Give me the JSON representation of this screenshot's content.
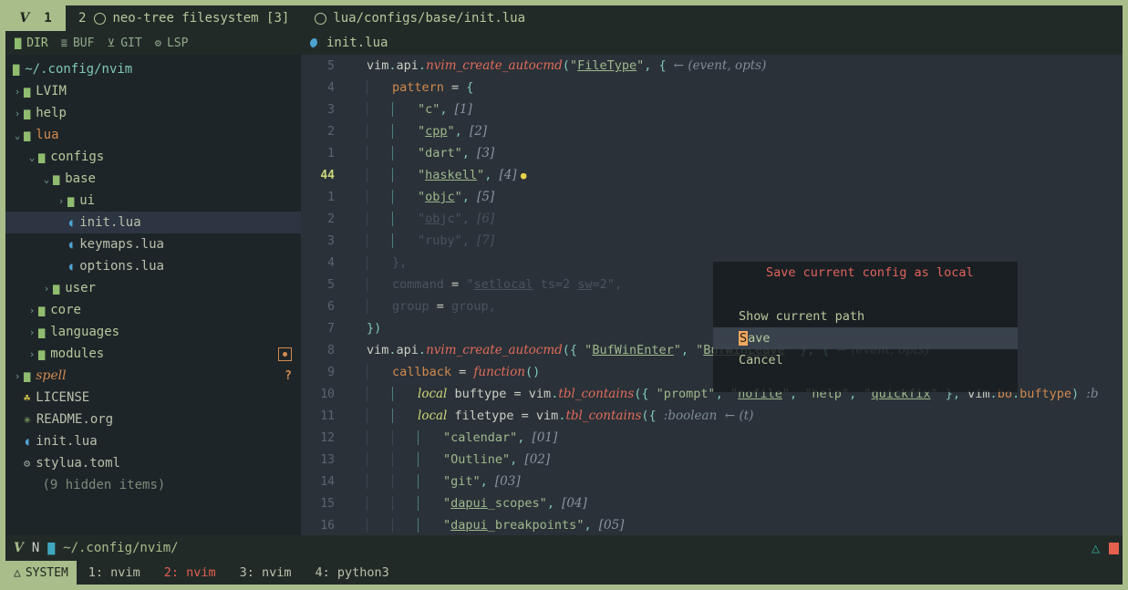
{
  "tabline": {
    "badge": {
      "glyph": "V",
      "count": "1"
    },
    "tabs": [
      {
        "num": "2",
        "icon": "circle-icon",
        "label": "neo-tree filesystem [3]"
      },
      {
        "num": "",
        "icon": "circle-icon",
        "label": "lua/configs/base/init.lua"
      }
    ]
  },
  "winbar": {
    "buttons": [
      {
        "icon": "folder-icon",
        "label": "DIR",
        "active": true
      },
      {
        "icon": "list-icon",
        "label": "BUF",
        "active": false
      },
      {
        "icon": "git-branch-icon",
        "label": "GIT",
        "active": false
      },
      {
        "icon": "gears-icon",
        "label": "LSP",
        "active": false
      }
    ],
    "file": {
      "icon": "lua-icon",
      "label": "init.lua"
    }
  },
  "sidebar": {
    "root": "~/.config/nvim",
    "items": [
      {
        "depth": 1,
        "chev": "›",
        "icon": "folder-icon",
        "label": "LVIM",
        "kind": "dir"
      },
      {
        "depth": 1,
        "chev": "›",
        "icon": "folder-icon",
        "label": "help",
        "kind": "dir"
      },
      {
        "depth": 1,
        "chev": "⌄",
        "icon": "folder-open-icon",
        "label": "lua",
        "kind": "open"
      },
      {
        "depth": 2,
        "chev": "⌄",
        "icon": "folder-open-icon",
        "label": "configs",
        "kind": "dir"
      },
      {
        "depth": 3,
        "chev": "⌄",
        "icon": "folder-open-icon",
        "label": "base",
        "kind": "dir"
      },
      {
        "depth": 4,
        "chev": "›",
        "icon": "folder-icon",
        "label": "ui",
        "kind": "dir"
      },
      {
        "depth": 4,
        "chev": "",
        "icon": "lua-icon",
        "label": "init.lua",
        "kind": "file",
        "selected": true
      },
      {
        "depth": 4,
        "chev": "",
        "icon": "lua-icon",
        "label": "keymaps.lua",
        "kind": "file"
      },
      {
        "depth": 4,
        "chev": "",
        "icon": "lua-icon",
        "label": "options.lua",
        "kind": "file"
      },
      {
        "depth": 3,
        "chev": "›",
        "icon": "folder-icon",
        "label": "user",
        "kind": "dir"
      },
      {
        "depth": 2,
        "chev": "›",
        "icon": "folder-icon",
        "label": "core",
        "kind": "dir"
      },
      {
        "depth": 2,
        "chev": "›",
        "icon": "folder-icon",
        "label": "languages",
        "kind": "dir"
      },
      {
        "depth": 2,
        "chev": "›",
        "icon": "folder-icon",
        "label": "modules",
        "kind": "dir",
        "badge": "square-dot-badge"
      },
      {
        "depth": 1,
        "chev": "›",
        "icon": "folder-icon",
        "label": "spell",
        "kind": "spell",
        "badge": "question-badge"
      },
      {
        "depth": 1,
        "chev": "",
        "icon": "license-icon",
        "label": "LICENSE",
        "kind": "file"
      },
      {
        "depth": 1,
        "chev": "",
        "icon": "org-star-icon",
        "label": "README.org",
        "kind": "file"
      },
      {
        "depth": 1,
        "chev": "",
        "icon": "lua-icon",
        "label": "init.lua",
        "kind": "file"
      },
      {
        "depth": 1,
        "chev": "",
        "icon": "gear-icon",
        "label": "stylua.toml",
        "kind": "file"
      },
      {
        "depth": 1,
        "chev": "",
        "icon": "",
        "label": "(9 hidden items)",
        "kind": "hidden"
      }
    ]
  },
  "editor": {
    "lines": [
      {
        "gutter": "5",
        "current": false,
        "guides": 0,
        "faded": false,
        "tokens": [
          {
            "c": "t-plain",
            "t": "vim"
          },
          {
            "c": "t-punc",
            "t": "."
          },
          {
            "c": "t-plain",
            "t": "api"
          },
          {
            "c": "t-punc",
            "t": "."
          },
          {
            "c": "t-fn",
            "t": "nvim_create_autocmd"
          },
          {
            "c": "t-punc",
            "t": "("
          },
          {
            "c": "t-str",
            "t": "\""
          },
          {
            "c": "t-strl",
            "t": "FileType"
          },
          {
            "c": "t-str",
            "t": "\""
          },
          {
            "c": "t-punc",
            "t": ", "
          },
          {
            "c": "t-punc",
            "t": "{ "
          },
          {
            "c": "t-hint",
            "t": "← (event, opts)"
          }
        ],
        "indent": 0
      },
      {
        "gutter": "4",
        "current": false,
        "guides": 1,
        "faded": false,
        "tokens": [
          {
            "c": "t-mod",
            "t": "pattern"
          },
          {
            "c": "t-op",
            "t": " = "
          },
          {
            "c": "t-punc",
            "t": "{"
          }
        ],
        "indent": 1
      },
      {
        "gutter": "3",
        "current": false,
        "guides": 2,
        "faded": false,
        "tokens": [
          {
            "c": "t-str",
            "t": "\"c\""
          },
          {
            "c": "t-punc",
            "t": ", "
          },
          {
            "c": "t-num",
            "t": "[1]"
          }
        ],
        "indent": 2
      },
      {
        "gutter": "2",
        "current": false,
        "guides": 2,
        "faded": false,
        "tokens": [
          {
            "c": "t-str",
            "t": "\""
          },
          {
            "c": "t-strl",
            "t": "cpp"
          },
          {
            "c": "t-str",
            "t": "\""
          },
          {
            "c": "t-punc",
            "t": ", "
          },
          {
            "c": "t-num",
            "t": "[2]"
          }
        ],
        "indent": 2
      },
      {
        "gutter": "1",
        "current": false,
        "guides": 2,
        "faded": false,
        "tokens": [
          {
            "c": "t-str",
            "t": "\"dart\""
          },
          {
            "c": "t-punc",
            "t": ", "
          },
          {
            "c": "t-num",
            "t": "[3]"
          }
        ],
        "indent": 2
      },
      {
        "gutter": "44",
        "current": true,
        "guides": 2,
        "faded": false,
        "tokens": [
          {
            "c": "t-str",
            "t": "\""
          },
          {
            "c": "t-strl",
            "t": "haskell"
          },
          {
            "c": "t-str",
            "t": "\""
          },
          {
            "c": "t-punc",
            "t": ", "
          },
          {
            "c": "t-num",
            "t": "[4] "
          },
          {
            "c": "bulb",
            "t": "●"
          }
        ],
        "indent": 2
      },
      {
        "gutter": "1",
        "current": false,
        "guides": 2,
        "faded": false,
        "tokens": [
          {
            "c": "t-str",
            "t": "\""
          },
          {
            "c": "t-strl",
            "t": "objc"
          },
          {
            "c": "t-str",
            "t": "\""
          },
          {
            "c": "t-punc",
            "t": ", "
          },
          {
            "c": "t-num",
            "t": "[5]"
          }
        ],
        "indent": 2
      },
      {
        "gutter": "2",
        "current": false,
        "guides": 2,
        "faded": true,
        "tokens": [
          {
            "c": "t-str",
            "t": "\""
          },
          {
            "c": "t-strl",
            "t": "ob"
          },
          {
            "c": "t-str",
            "t": "jc\""
          },
          {
            "c": "t-punc",
            "t": ", "
          },
          {
            "c": "t-num",
            "t": "[6]"
          }
        ],
        "indent": 2
      },
      {
        "gutter": "3",
        "current": false,
        "guides": 2,
        "faded": true,
        "tokens": [
          {
            "c": "t-str",
            "t": "\"ruby\""
          },
          {
            "c": "t-punc",
            "t": ", "
          },
          {
            "c": "t-num",
            "t": "[7]"
          }
        ],
        "indent": 2
      },
      {
        "gutter": "4",
        "current": false,
        "guides": 1,
        "faded": true,
        "tokens": [
          {
            "c": "t-punc",
            "t": "},"
          }
        ],
        "indent": 1
      },
      {
        "gutter": "5",
        "current": false,
        "guides": 1,
        "faded": true,
        "tokens": [
          {
            "c": "t-mod",
            "t": "command"
          },
          {
            "c": "t-op",
            "t": " = "
          },
          {
            "c": "t-str",
            "t": "\""
          },
          {
            "c": "t-strl",
            "t": "setlocal"
          },
          {
            "c": "t-str",
            "t": " ts=2 "
          },
          {
            "c": "t-strl",
            "t": "sw"
          },
          {
            "c": "t-str",
            "t": "=2\""
          },
          {
            "c": "t-punc",
            "t": ","
          }
        ],
        "indent": 1
      },
      {
        "gutter": "6",
        "current": false,
        "guides": 1,
        "faded": true,
        "tokens": [
          {
            "c": "t-mod",
            "t": "group"
          },
          {
            "c": "t-op",
            "t": " = "
          },
          {
            "c": "t-plain",
            "t": "group"
          },
          {
            "c": "t-punc",
            "t": ","
          }
        ],
        "indent": 1
      },
      {
        "gutter": "7",
        "current": false,
        "guides": 0,
        "faded": false,
        "tokens": [
          {
            "c": "t-punc",
            "t": "})"
          }
        ],
        "indent": 0
      },
      {
        "gutter": "8",
        "current": false,
        "guides": 0,
        "faded": false,
        "tokens": [
          {
            "c": "t-plain",
            "t": "vim"
          },
          {
            "c": "t-punc",
            "t": "."
          },
          {
            "c": "t-plain",
            "t": "api"
          },
          {
            "c": "t-punc",
            "t": "."
          },
          {
            "c": "t-fn",
            "t": "nvim_create_autocmd"
          },
          {
            "c": "t-punc",
            "t": "({ "
          },
          {
            "c": "t-str",
            "t": "\""
          },
          {
            "c": "t-strl",
            "t": "BufWinEnter"
          },
          {
            "c": "t-str",
            "t": "\""
          },
          {
            "c": "t-punc",
            "t": ", "
          },
          {
            "c": "t-str",
            "t": "\""
          },
          {
            "c": "t-strl",
            "t": "BufWinLeave"
          },
          {
            "c": "t-str",
            "t": "\""
          },
          {
            "c": "t-punc",
            "t": " }, { "
          },
          {
            "c": "t-hint",
            "t": "← (event, opts)"
          }
        ],
        "indent": 0
      },
      {
        "gutter": "9",
        "current": false,
        "guides": 1,
        "faded": false,
        "tokens": [
          {
            "c": "t-mod",
            "t": "callback"
          },
          {
            "c": "t-op",
            "t": " = "
          },
          {
            "c": "t-fn",
            "t": "function"
          },
          {
            "c": "t-punc",
            "t": "()"
          }
        ],
        "indent": 1
      },
      {
        "gutter": "10",
        "current": false,
        "guides": 2,
        "faded": false,
        "tokens": [
          {
            "c": "t-local",
            "t": "local"
          },
          {
            "c": "t-plain",
            "t": " buftype "
          },
          {
            "c": "t-op",
            "t": "= "
          },
          {
            "c": "t-plain",
            "t": "vim"
          },
          {
            "c": "t-punc",
            "t": "."
          },
          {
            "c": "t-fn",
            "t": "tbl_contains"
          },
          {
            "c": "t-punc",
            "t": "({ "
          },
          {
            "c": "t-str",
            "t": "\"prompt\""
          },
          {
            "c": "t-punc",
            "t": ", "
          },
          {
            "c": "t-str",
            "t": "\""
          },
          {
            "c": "t-strl",
            "t": "nofile"
          },
          {
            "c": "t-str",
            "t": "\""
          },
          {
            "c": "t-punc",
            "t": ", "
          },
          {
            "c": "t-str",
            "t": "\"help\""
          },
          {
            "c": "t-punc",
            "t": ", "
          },
          {
            "c": "t-str",
            "t": "\""
          },
          {
            "c": "t-strl",
            "t": "quickfix"
          },
          {
            "c": "t-str",
            "t": "\""
          },
          {
            "c": "t-punc",
            "t": " }, "
          },
          {
            "c": "t-plain",
            "t": "vim"
          },
          {
            "c": "t-punc",
            "t": "."
          },
          {
            "c": "t-mod",
            "t": "bo"
          },
          {
            "c": "t-punc",
            "t": "."
          },
          {
            "c": "t-mod",
            "t": "buftype"
          },
          {
            "c": "t-punc",
            "t": ") "
          },
          {
            "c": "t-hint",
            "t": ":b"
          }
        ],
        "indent": 2
      },
      {
        "gutter": "11",
        "current": false,
        "guides": 2,
        "faded": false,
        "tokens": [
          {
            "c": "t-local",
            "t": "local"
          },
          {
            "c": "t-plain",
            "t": " filetype "
          },
          {
            "c": "t-op",
            "t": "= "
          },
          {
            "c": "t-plain",
            "t": "vim"
          },
          {
            "c": "t-punc",
            "t": "."
          },
          {
            "c": "t-fn",
            "t": "tbl_contains"
          },
          {
            "c": "t-punc",
            "t": "({ "
          },
          {
            "c": "t-hint",
            "t": ":boolean  ← (t)"
          }
        ],
        "indent": 2
      },
      {
        "gutter": "12",
        "current": false,
        "guides": 3,
        "faded": false,
        "tokens": [
          {
            "c": "t-str",
            "t": "\"calendar\""
          },
          {
            "c": "t-punc",
            "t": ", "
          },
          {
            "c": "t-num",
            "t": "[01]"
          }
        ],
        "indent": 3
      },
      {
        "gutter": "13",
        "current": false,
        "guides": 3,
        "faded": false,
        "tokens": [
          {
            "c": "t-str",
            "t": "\"Outline\""
          },
          {
            "c": "t-punc",
            "t": ", "
          },
          {
            "c": "t-num",
            "t": "[02]"
          }
        ],
        "indent": 3
      },
      {
        "gutter": "14",
        "current": false,
        "guides": 3,
        "faded": false,
        "tokens": [
          {
            "c": "t-str",
            "t": "\"git\""
          },
          {
            "c": "t-punc",
            "t": ", "
          },
          {
            "c": "t-num",
            "t": "[03]"
          }
        ],
        "indent": 3
      },
      {
        "gutter": "15",
        "current": false,
        "guides": 3,
        "faded": false,
        "tokens": [
          {
            "c": "t-str",
            "t": "\""
          },
          {
            "c": "t-strl",
            "t": "dapui"
          },
          {
            "c": "t-str",
            "t": "_scopes\""
          },
          {
            "c": "t-punc",
            "t": ", "
          },
          {
            "c": "t-num",
            "t": "[04]"
          }
        ],
        "indent": 3
      },
      {
        "gutter": "16",
        "current": false,
        "guides": 3,
        "faded": false,
        "tokens": [
          {
            "c": "t-str",
            "t": "\""
          },
          {
            "c": "t-strl",
            "t": "dapui"
          },
          {
            "c": "t-str",
            "t": "_breakpoints\""
          },
          {
            "c": "t-punc",
            "t": ", "
          },
          {
            "c": "t-num",
            "t": "[05]"
          }
        ],
        "indent": 3
      }
    ]
  },
  "dialog": {
    "prompt": "Save current config as local",
    "items": [
      {
        "label": "Show current path",
        "accel": "",
        "selected": false
      },
      {
        "label": "Save",
        "accel": "S",
        "selected": true
      },
      {
        "label": "Cancel",
        "accel": "",
        "selected": false
      }
    ]
  },
  "statusline": {
    "vim_glyph": "V",
    "mode": "N",
    "folder_icon": "folder-icon",
    "path": "~/.config/nvim/",
    "right_icon": "tux-icon"
  },
  "tmux": {
    "session": {
      "icon": "tux-icon",
      "label": "SYSTEM"
    },
    "windows": [
      {
        "label": "1: nvim",
        "active": false
      },
      {
        "label": "2: nvim",
        "active": true
      },
      {
        "label": "3: nvim",
        "active": false
      },
      {
        "label": "4: python3",
        "active": false
      }
    ]
  },
  "colors": {
    "accent_green": "#a8bd8a",
    "editor_bg": "#2a3138",
    "sidebar_bg": "#1e2529",
    "bar_bg": "#222a28",
    "orange": "#d08a4f",
    "red": "#e4604f"
  }
}
